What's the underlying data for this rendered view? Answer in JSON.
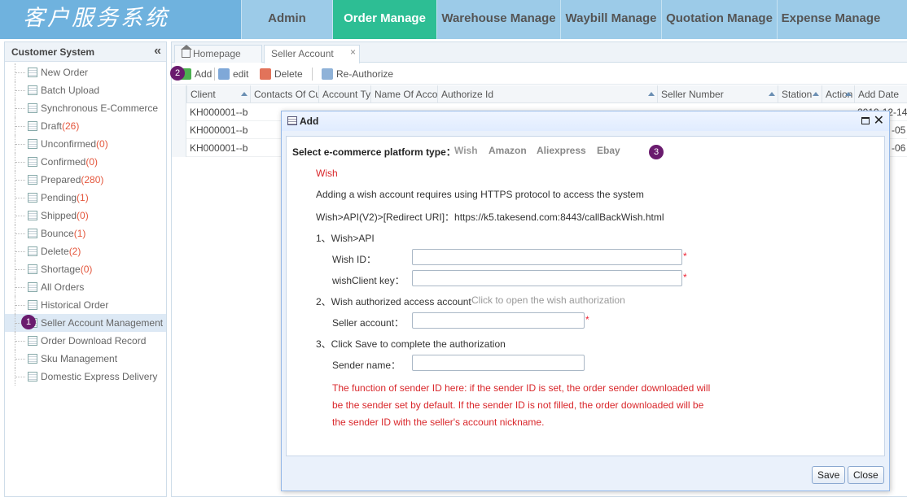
{
  "header": {
    "logo": "客户服务系统",
    "nav": [
      {
        "label": "Admin",
        "active": false
      },
      {
        "label": "Order Manage",
        "active": true
      },
      {
        "label": "Warehouse Manage",
        "active": false
      },
      {
        "label": "Waybill Manage",
        "active": false
      },
      {
        "label": "Quotation Manage",
        "active": false
      },
      {
        "label": "Expense Manage",
        "active": false
      }
    ]
  },
  "sidebar": {
    "title": "Customer System",
    "collapse_icon": "double-chevron-left-icon",
    "items": [
      {
        "label": "New Order",
        "count": ""
      },
      {
        "label": "Batch Upload",
        "count": ""
      },
      {
        "label": "Synchronous E-Commerce",
        "count": ""
      },
      {
        "label": "Draft",
        "count": "(26)"
      },
      {
        "label": "Unconfirmed",
        "count": "(0)"
      },
      {
        "label": "Confirmed",
        "count": "(0)"
      },
      {
        "label": "Prepared",
        "count": "(280)"
      },
      {
        "label": "Pending",
        "count": "(1)"
      },
      {
        "label": "Shipped",
        "count": "(0)"
      },
      {
        "label": "Bounce",
        "count": "(1)"
      },
      {
        "label": "Delete",
        "count": "(2)"
      },
      {
        "label": "Shortage",
        "count": "(0)"
      },
      {
        "label": "All Orders",
        "count": ""
      },
      {
        "label": "Historical Order",
        "count": ""
      },
      {
        "label": "Seller Account Management",
        "count": ""
      },
      {
        "label": "Order Download Record",
        "count": ""
      },
      {
        "label": "Sku Management",
        "count": ""
      },
      {
        "label": "Domestic Express Delivery",
        "count": ""
      }
    ],
    "selected_index": 14
  },
  "badges": {
    "one": "1",
    "two": "2",
    "three": "3"
  },
  "tabs": {
    "home": "Homepage",
    "seller": "Seller Account",
    "close": "×"
  },
  "toolbar": {
    "add": "Add",
    "edit": "edit",
    "delete": "Delete",
    "reauth": "Re-Authorize"
  },
  "grid": {
    "columns": [
      "Client",
      "Contacts Of Cu",
      "Account Ty",
      "Name Of Acco",
      "Authorize Id",
      "Seller Number",
      "Station",
      "Action",
      "Add Date"
    ],
    "rows": [
      {
        "client": "KH000001--b",
        "date": "2019-12-14"
      },
      {
        "client": "KH000001--b",
        "date": "-05"
      },
      {
        "client": "KH000001--b",
        "date": "-06"
      }
    ]
  },
  "modal": {
    "title": "Add",
    "platform_label": "Select e-commerce platform type：",
    "platforms": [
      "Wish",
      "Amazon",
      "Aliexpress",
      "Ebay"
    ],
    "section_title": "Wish",
    "https_note": "Adding a wish account requires using HTTPS protocol to access the system",
    "redirect": "Wish>API(V2)>[Redirect URI]：https://k5.takesend.com:8443/callBackWish.html",
    "step1": "1、Wish>API",
    "wish_id_label": "Wish ID：",
    "client_key_label": "wishClient key：",
    "step2": "2、Wish authorized access account",
    "step2_link": "Click to open the wish authorization",
    "seller_account_label": "Seller account：",
    "step3": "3、Click Save to complete the authorization",
    "sender_name_label": "Sender name：",
    "note_line1": "The function of sender ID here: if the sender ID is set, the order sender downloaded will",
    "note_line2": "be the sender set by default. If the sender ID is not filled, the order downloaded will be",
    "note_line3": "the sender ID with the seller's account nickname.",
    "save": "Save",
    "close": "Close",
    "required_mark": "*"
  }
}
